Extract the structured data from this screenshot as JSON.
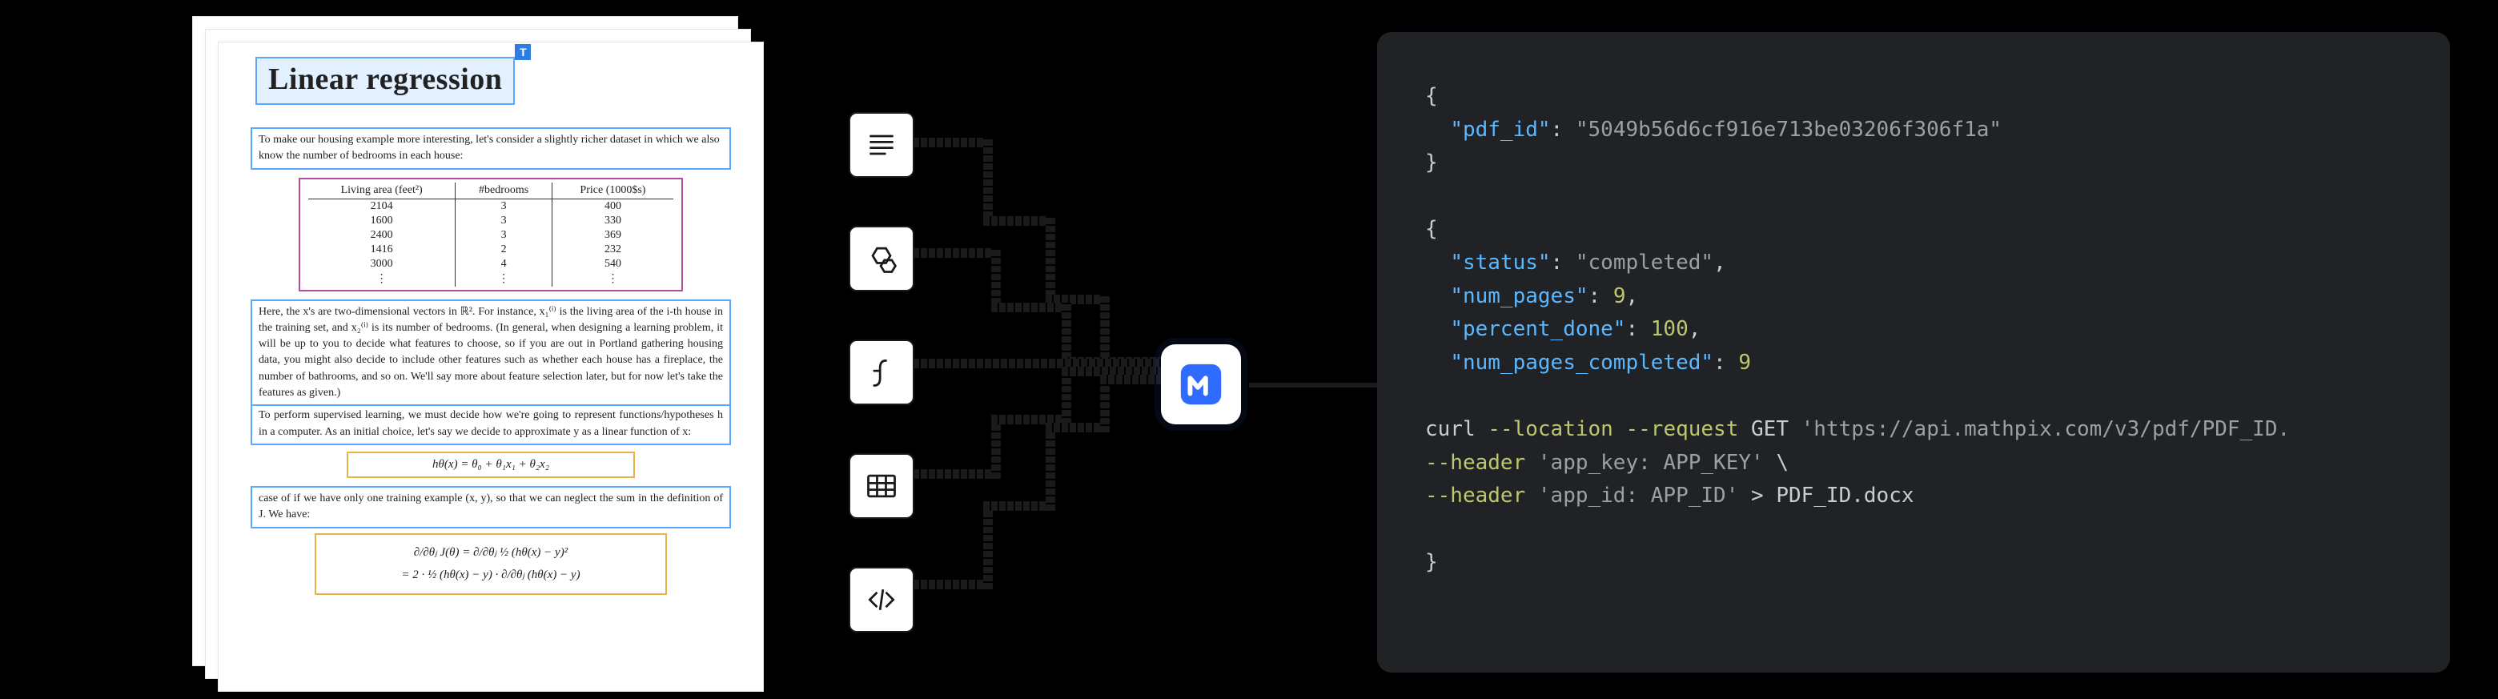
{
  "document": {
    "title": "Linear regression",
    "title_badge": "T",
    "intro": "To make our housing example more interesting, let's consider a slightly richer dataset in which we also know the number of bedrooms in each house:",
    "table": {
      "headers": [
        "Living area (feet²)",
        "#bedrooms",
        "Price (1000$s)"
      ],
      "rows": [
        [
          "2104",
          "3",
          "400"
        ],
        [
          "1600",
          "3",
          "330"
        ],
        [
          "2400",
          "3",
          "369"
        ],
        [
          "1416",
          "2",
          "232"
        ],
        [
          "3000",
          "4",
          "540"
        ],
        [
          "⋮",
          "⋮",
          "⋮"
        ]
      ]
    },
    "para2": "Here, the x's are two-dimensional vectors in ℝ². For instance, x₁⁽ⁱ⁾ is the living area of the i-th house in the training set, and x₂⁽ⁱ⁾ is its number of bedrooms. (In general, when designing a learning problem, it will be up to you to decide what features to choose, so if you are out in Portland gathering housing data, you might also decide to include other features such as whether each house has a fireplace, the number of bathrooms, and so on. We'll say more about feature selection later, but for now let's take the features as given.)",
    "para3": "To perform supervised learning, we must decide how we're going to represent functions/hypotheses h in a computer. As an initial choice, let's say we decide to approximate y as a linear function of x:",
    "equation1": "hθ(x) = θ₀ + θ₁x₁ + θ₂x₂",
    "para4": "case of if we have only one training example (x, y), so that we can neglect the sum in the definition of J. We have:",
    "equation2a": "∂/∂θⱼ J(θ)  =  ∂/∂θⱼ ½ (hθ(x) − y)²",
    "equation2b": "=  2 · ½ (hθ(x) − y) · ∂/∂θⱼ (hθ(x) − y)"
  },
  "types": {
    "text": "text-icon",
    "chem": "molecule-icon",
    "math": "function-icon",
    "table": "table-icon",
    "code": "code-icon"
  },
  "logo_name": "mathpix",
  "api": {
    "request": {
      "pdf_id": "5049b56d6cf916e713be03206f306f1a"
    },
    "response": {
      "status": "completed",
      "num_pages": 9,
      "percent_done": 100,
      "num_pages_completed": 9
    },
    "curl": {
      "cmd": "curl",
      "flag_location": "--location",
      "flag_request": "--request",
      "method": "GET",
      "url": "'https://api.mathpix.com/v3/pdf/PDF_ID.",
      "header1_flag": "--header",
      "header1_val": "'app_key: APP_KEY'",
      "cont": "\\",
      "header2_flag": "--header",
      "header2_val": "'app_id: APP_ID'",
      "redirect": ">",
      "outfile": "PDF_ID.docx"
    }
  }
}
